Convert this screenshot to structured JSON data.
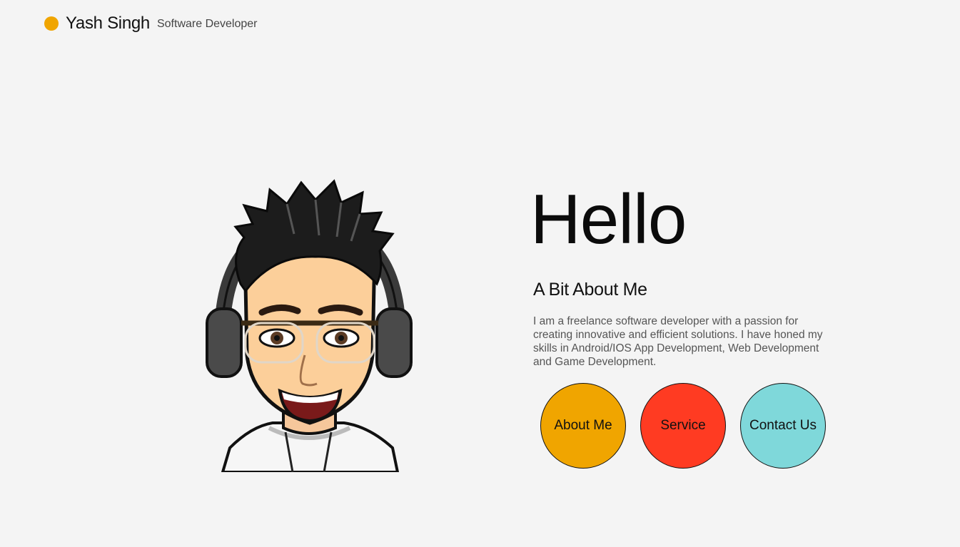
{
  "header": {
    "name": "Yash Singh",
    "role": "Software Developer"
  },
  "hero": {
    "greeting": "Hello",
    "heading": "A Bit About Me",
    "bio": "I am a freelance software developer with a passion for creating innovative and efficient solutions. I have honed my skills in Android/IOS App Development, Web Development and Game Development."
  },
  "buttons": {
    "about": "About Me",
    "service": "Service",
    "contact": "Contact Us"
  },
  "colors": {
    "accent_orange": "#f0a500",
    "accent_red": "#ff3b22",
    "accent_teal": "#7fd8da",
    "background": "#f4f4f4"
  },
  "icons": {
    "logo": "logo-dot-icon",
    "avatar": "avatar-illustration"
  }
}
